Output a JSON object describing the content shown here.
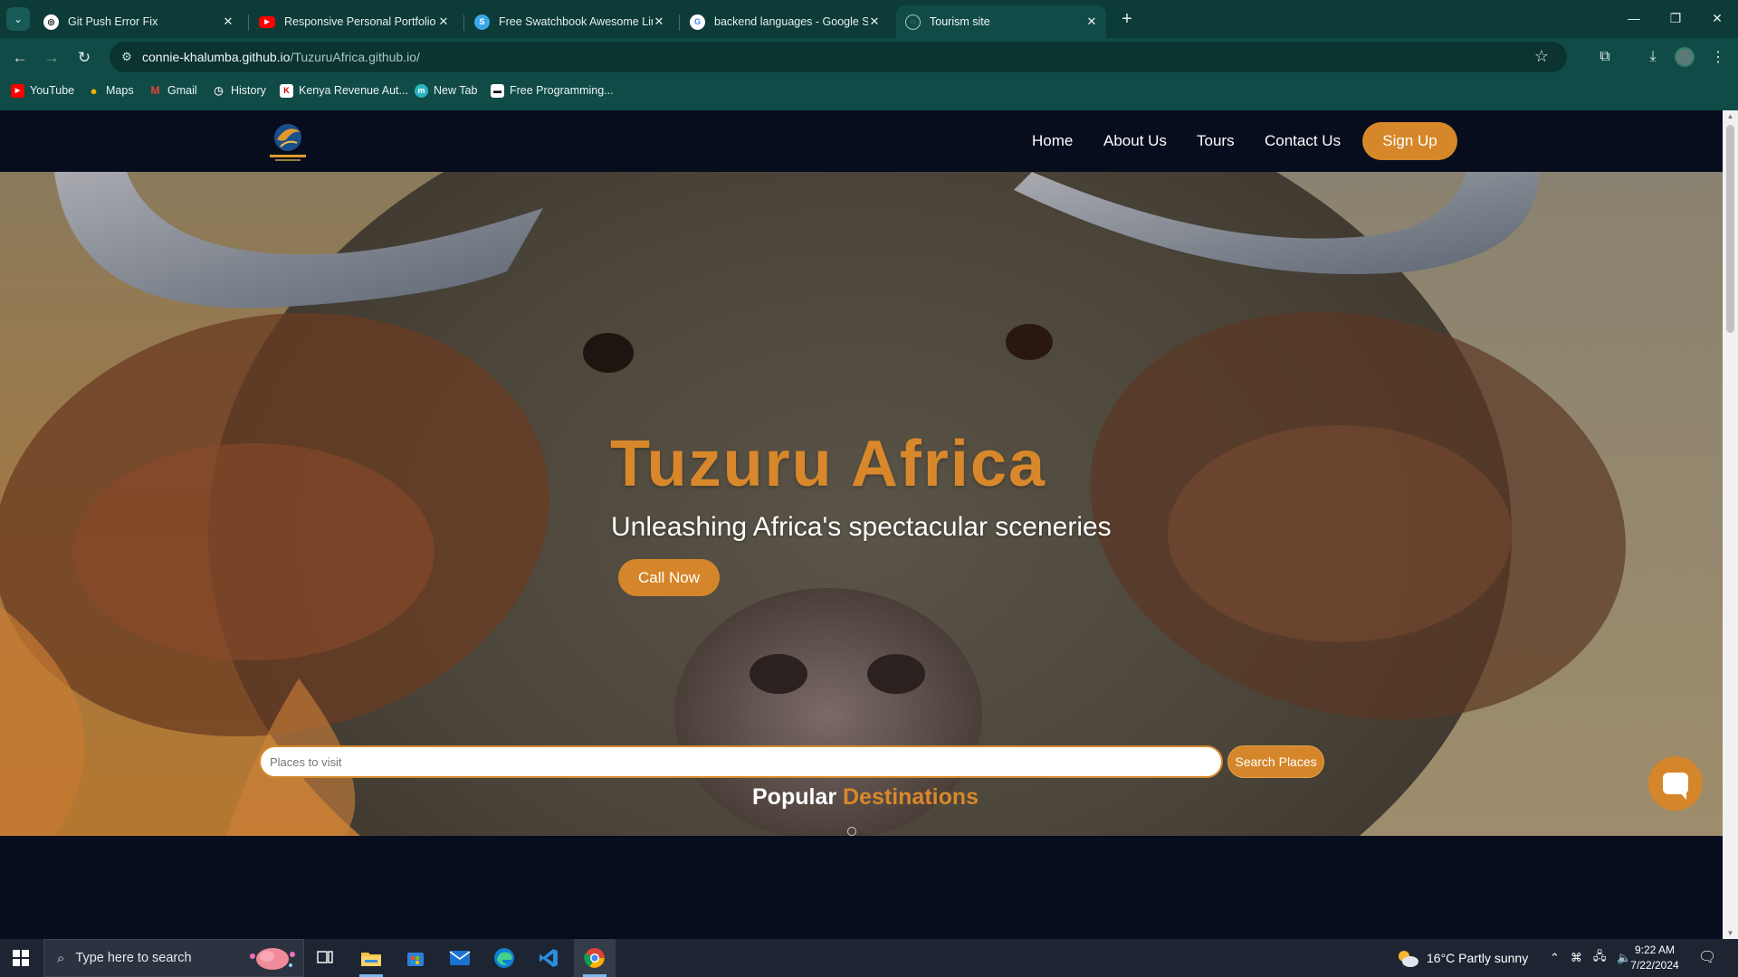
{
  "browser": {
    "tabs": [
      {
        "title": "Git Push Error Fix",
        "icon": "openai-icon",
        "active": false
      },
      {
        "title": "Responsive Personal Portfolio W",
        "icon": "youtube-icon",
        "active": false
      },
      {
        "title": "Free Swatchbook Awesome Lin",
        "icon": "swatchbook-icon",
        "active": false
      },
      {
        "title": "backend languages - Google Se",
        "icon": "google-icon",
        "active": false
      },
      {
        "title": "Tourism site",
        "icon": "globe-icon",
        "active": true
      }
    ],
    "url_host": "connie-khalumba.github.io",
    "url_path": "/TuzuruAfrica.github.io/",
    "bookmarks": [
      {
        "label": "YouTube",
        "icon": "youtube-icon"
      },
      {
        "label": "Maps",
        "icon": "maps-icon"
      },
      {
        "label": "Gmail",
        "icon": "gmail-icon"
      },
      {
        "label": "History",
        "icon": "history-icon"
      },
      {
        "label": "Kenya Revenue Aut...",
        "icon": "kra-icon"
      },
      {
        "label": "New Tab",
        "icon": "newtab-icon"
      },
      {
        "label": "Free Programming...",
        "icon": "freecodecamp-icon"
      }
    ]
  },
  "site": {
    "nav": {
      "links": [
        "Home",
        "About Us",
        "Tours",
        "Contact Us"
      ],
      "signup": "Sign Up"
    },
    "hero": {
      "title": "Tuzuru Africa",
      "subtitle": "Unleashing Africa's spectacular sceneries",
      "cta": "Call Now"
    },
    "search": {
      "placeholder": "Places to visit",
      "button": "Search Places"
    },
    "section_title_part1": "Popular",
    "section_title_part2": "Destinations"
  },
  "taskbar": {
    "search_placeholder": "Type here to search",
    "weather": "16°C  Partly sunny",
    "time": "9:22 AM",
    "date": "7/22/2024",
    "apps": [
      "task-view-icon",
      "file-explorer-icon",
      "microsoft-store-icon",
      "mail-icon",
      "edge-icon",
      "vscode-icon",
      "chrome-icon"
    ]
  },
  "colors": {
    "accent": "#d5862a",
    "browser_frame": "#114b47",
    "page_bg": "#070d1d"
  }
}
